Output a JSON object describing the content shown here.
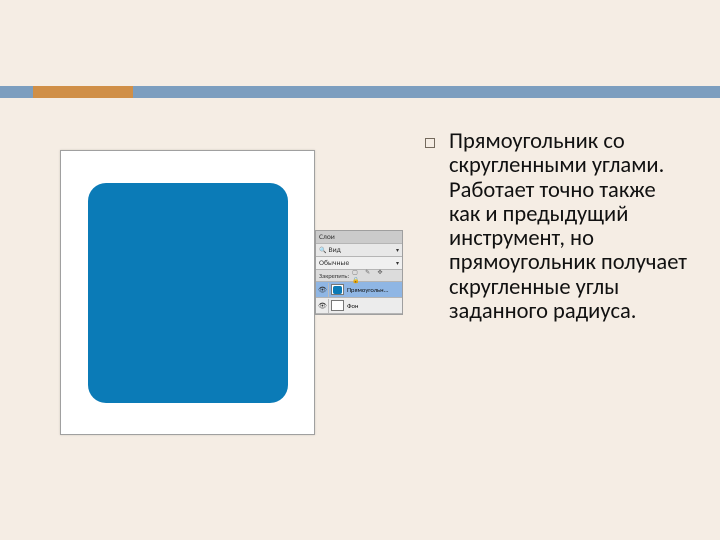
{
  "layers_panel": {
    "tab_label": "Слои",
    "search_label": "Вид",
    "mode_label": "Обычные",
    "lock_label": "Закрепить:",
    "layer1_name": "Прямоугольн...",
    "layer2_name": "Фон"
  },
  "description": "Прямоугольник со скругленными углами. Работает точно также как и предыдущий инструмент, но прямоугольник получает скругленные углы заданного радиуса."
}
